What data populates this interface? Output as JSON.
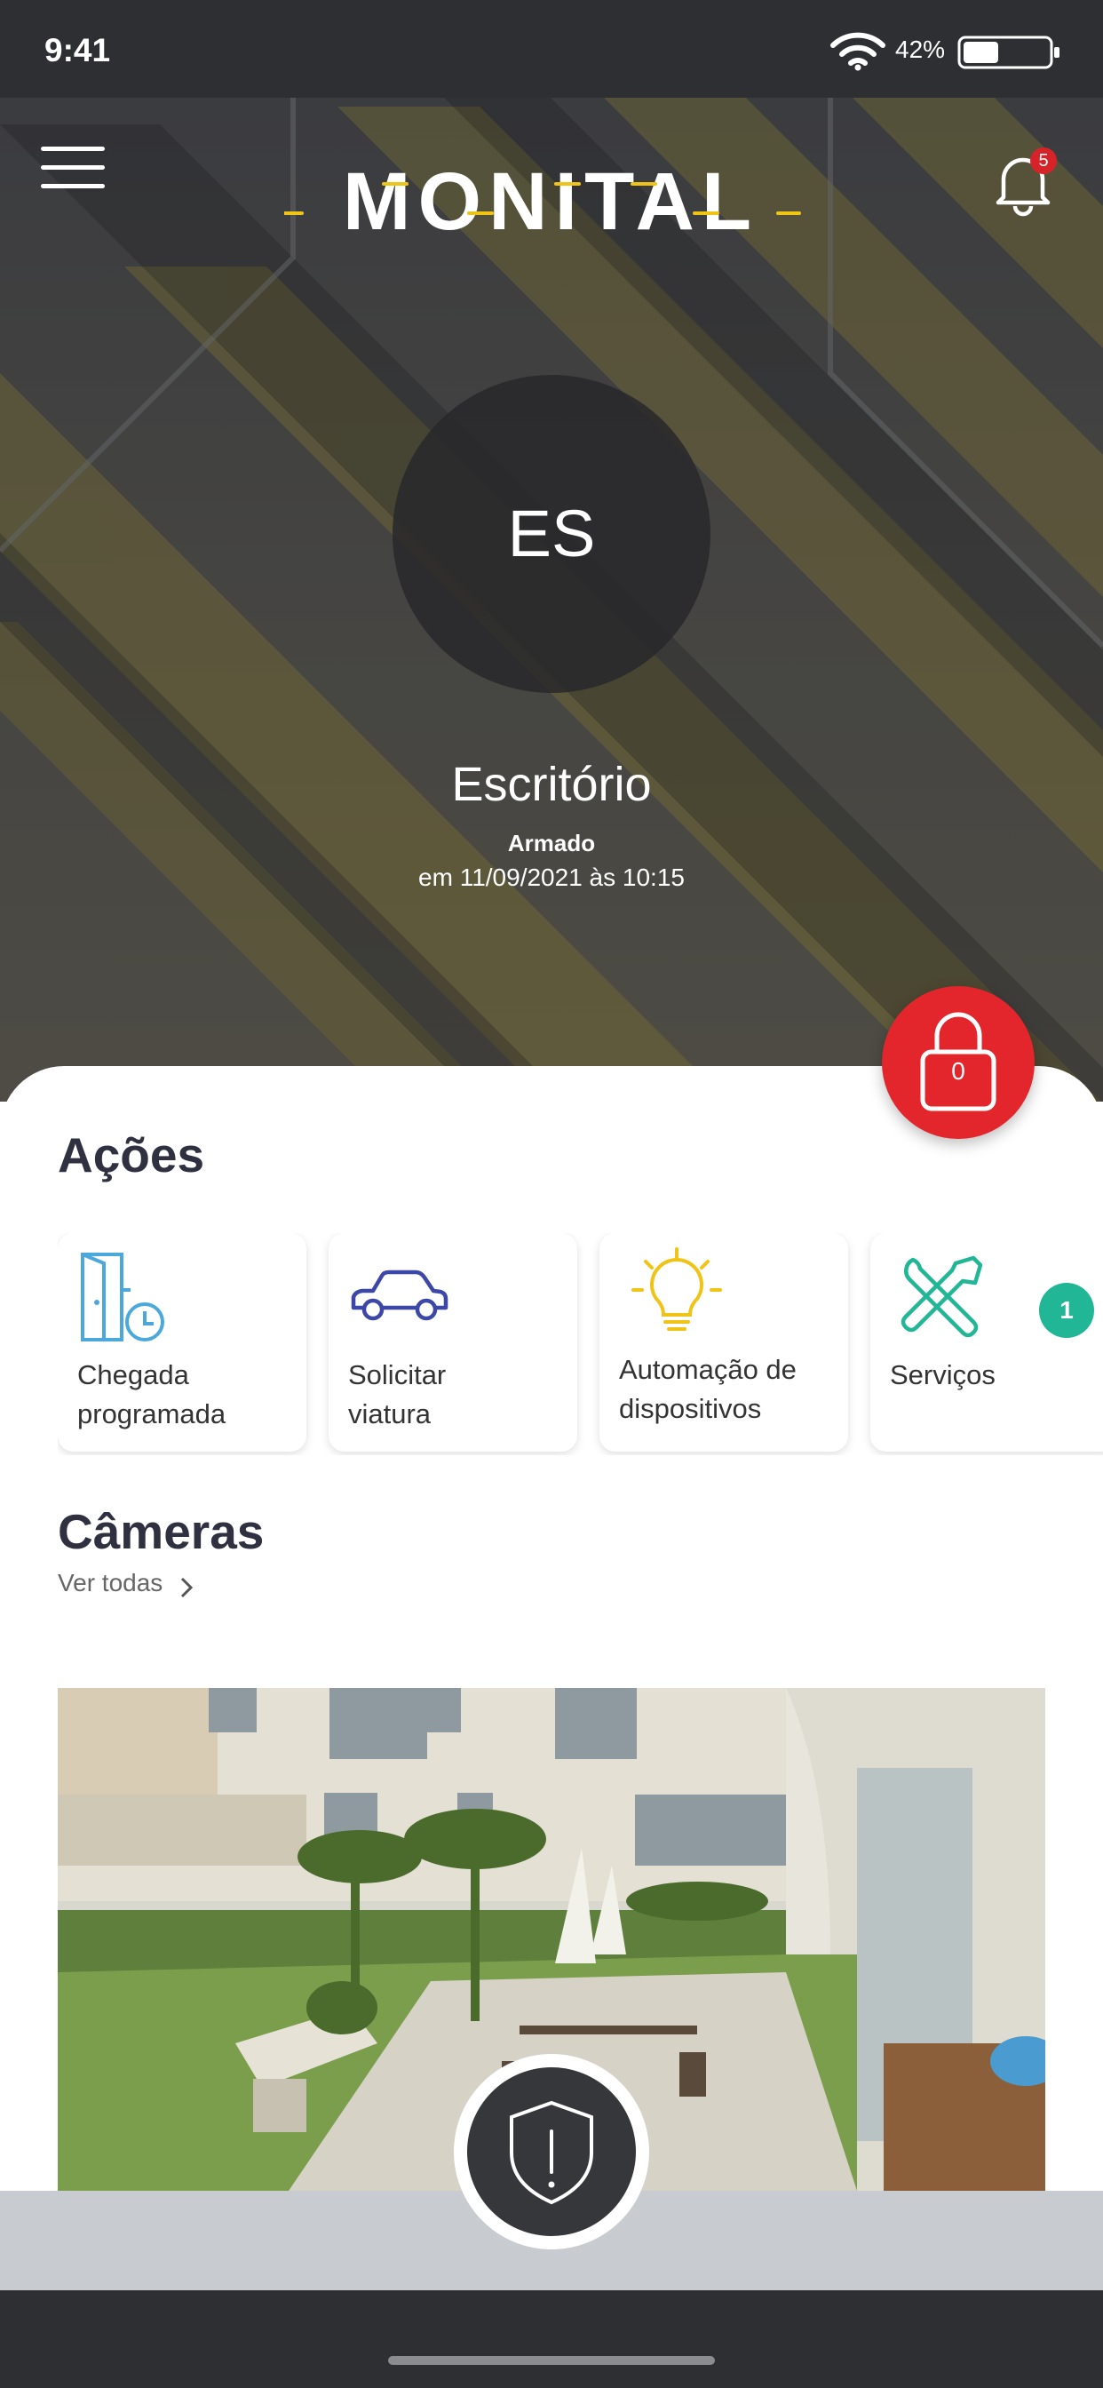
{
  "status_bar": {
    "time": "9:41",
    "battery_percent": "42%",
    "battery_level": 0.42
  },
  "header": {
    "logo_text": "MONITAL",
    "notifications_count": "5"
  },
  "site": {
    "initials": "ES",
    "name": "Escritório",
    "status": "Armado",
    "status_time": "em 11/09/2021 às 10:15"
  },
  "lock": {
    "count": "0"
  },
  "actions": {
    "title": "Ações",
    "items": [
      {
        "label": "Chegada programada",
        "icon": "door-clock-icon"
      },
      {
        "label": "Solicitar viatura",
        "icon": "car-icon"
      },
      {
        "label": "Automação de dispositivos",
        "icon": "lightbulb-icon"
      },
      {
        "label": "Serviços",
        "icon": "tools-icon",
        "badge": "1"
      }
    ]
  },
  "cameras": {
    "title": "Câmeras",
    "view_all": "Ver todas"
  },
  "colors": {
    "brand_yellow": "#f0c417",
    "lock_red": "#e3262c",
    "badge_green": "#21b696",
    "dark": "#36373b"
  }
}
